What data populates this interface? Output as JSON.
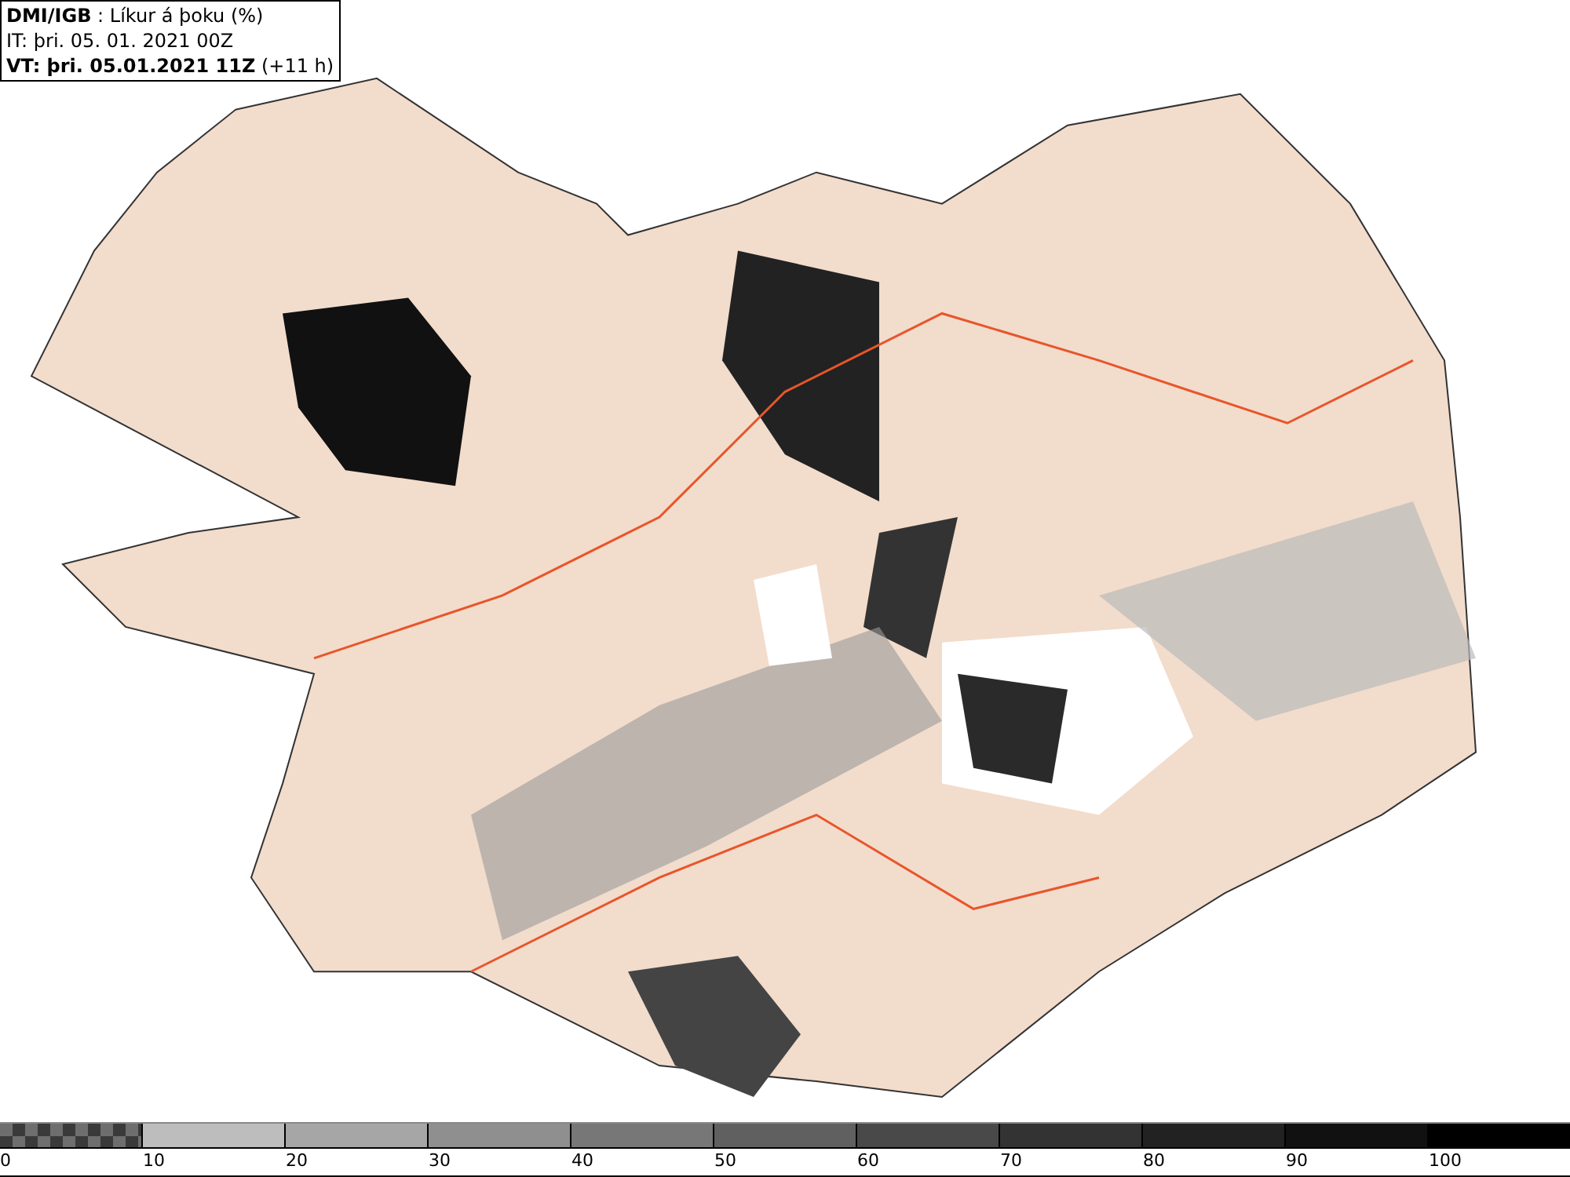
{
  "header": {
    "lines": [
      "**DMI/IGB** : Líkur á þoku (%)",
      "IT: þri. 05. 01. 2021 00Z",
      "**VT: þri. 05.01.2021 11Z** (+11 h)"
    ]
  },
  "legend": {
    "segments": [
      {
        "kind": "checker",
        "color": "#6e6e6e"
      },
      {
        "kind": "solid",
        "color": "#bdbdbd"
      },
      {
        "kind": "solid",
        "color": "#a6a6a6"
      },
      {
        "kind": "solid",
        "color": "#8f8f8f"
      },
      {
        "kind": "solid",
        "color": "#777777"
      },
      {
        "kind": "solid",
        "color": "#606060"
      },
      {
        "kind": "solid",
        "color": "#494949"
      },
      {
        "kind": "solid",
        "color": "#333333"
      },
      {
        "kind": "solid",
        "color": "#222222"
      },
      {
        "kind": "solid",
        "color": "#111111"
      },
      {
        "kind": "solid",
        "color": "#000000"
      }
    ],
    "labels": [
      "0",
      "10",
      "20",
      "30",
      "40",
      "50",
      "60",
      "70",
      "80",
      "90",
      "100"
    ]
  }
}
